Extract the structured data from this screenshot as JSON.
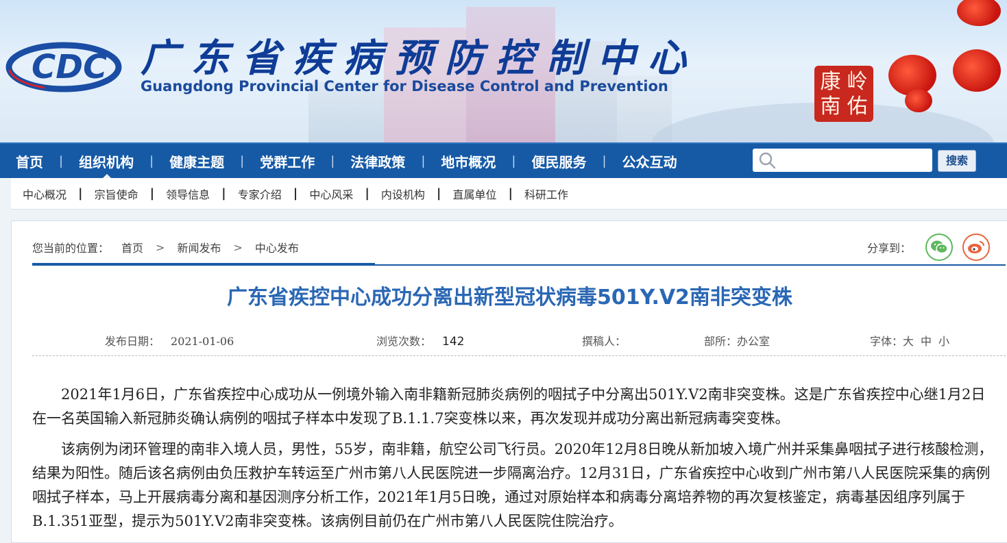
{
  "header": {
    "title_cn": "广东省疾病预防控制中心",
    "title_en": "Guangdong Provincial Center for Disease Control and Prevention",
    "logo_text": "CDC",
    "seal_text": [
      "康",
      "岭",
      "南",
      "佑"
    ]
  },
  "nav": {
    "items": [
      "首页",
      "组织机构",
      "健康主题",
      "党群工作",
      "法律政策",
      "地市概况",
      "便民服务",
      "公众互动"
    ],
    "search_placeholder": "",
    "search_button": "搜索"
  },
  "subnav": {
    "items": [
      "中心概况",
      "宗旨使命",
      "领导信息",
      "专家介绍",
      "中心风采",
      "内设机构",
      "直属单位",
      "科研工作"
    ]
  },
  "breadcrumb": {
    "label": "您当前的位置：",
    "items": [
      "首页",
      "新闻发布",
      "中心发布"
    ],
    "separator": ">"
  },
  "share": {
    "label": "分享到："
  },
  "article": {
    "title": "广东省疾控中心成功分离出新型冠状病毒501Y.V2南非突变株",
    "publish_label": "发布日期：",
    "publish_date": "2021-01-06",
    "views_label": "浏览次数：",
    "views": "142",
    "author_label": "撰稿人：",
    "author": "",
    "dept_label": "部所：办公室",
    "font_label": "字体：",
    "font_sizes": [
      "大",
      "中",
      "小"
    ],
    "paragraphs": [
      "2021年1月6日，广东省疾控中心成功从一例境外输入南非籍新冠肺炎病例的咽拭子中分离出501Y.V2南非突变株。这是广东省疾控中心继1月2日在一名英国输入新冠肺炎确认病例的咽拭子样本中发现了B.1.1.7突变株以来，再次发现并成功分离出新冠病毒突变株。",
      "该病例为闭环管理的南非入境人员，男性，55岁，南非籍，航空公司飞行员。2020年12月8日晚从新加坡入境广州并采集鼻咽拭子进行核酸检测，结果为阳性。随后该名病例由负压救护车转运至广州市第八人民医院进一步隔离治疗。12月31日，广东省疾控中心收到广州市第八人民医院采集的病例咽拭子样本，马上开展病毒分离和基因测序分析工作，2021年1月5日晚，通过对原始样本和病毒分离培养物的再次复核鉴定，病毒基因组序列属于B.1.351亚型，提示为501Y.V2南非突变株。该病例目前仍在广州市第八人民医院住院治疗。"
    ]
  },
  "colors": {
    "nav_bg": "#165aa6",
    "title_blue": "#2a67b4",
    "seal_red": "#c8281e"
  }
}
